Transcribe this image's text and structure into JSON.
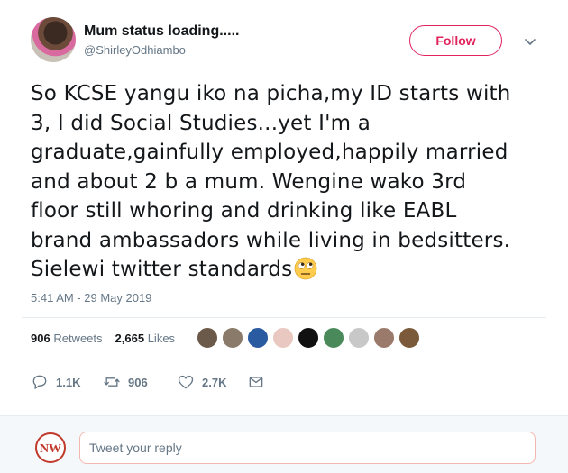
{
  "author": {
    "display_name": "Mum status loading.....",
    "username": "@ShirleyOdhiambo"
  },
  "follow_button": {
    "label": "Follow",
    "color": "#e0245e"
  },
  "menu": {
    "icon": "chevron-down-icon"
  },
  "tweet": {
    "line1": "So KCSE yangu iko na picha,my ID starts with",
    "line2": "3, I did Social Studies...yet I'm a",
    "line3": "graduate,gainfully employed,happily married",
    "line4": "and about 2 b a mum. Wengine wako 3rd",
    "line5": "floor still whoring and drinking like EABL",
    "line6": "brand ambassadors while living in bedsitters.",
    "line7": "Sielewi twitter standards",
    "emoji": "face-with-rolling-eyes-emoji"
  },
  "timestamp": "5:41 AM - 29 May 2019",
  "stats": {
    "retweets_count": "906",
    "retweets_label": "Retweets",
    "likes_count": "2,665",
    "likes_label": "Likes"
  },
  "liker_avatars": [
    "#6b5a4a",
    "#8a7a6a",
    "#2a5aa0",
    "#e8c8c0",
    "#111111",
    "#4a8a5a",
    "#c8c8c8",
    "#9a7a6a",
    "#7a5a3a"
  ],
  "actions": {
    "reply_count": "1.1K",
    "retweet_count": "906",
    "like_count": "2.7K"
  },
  "reply": {
    "logo_text": "NW",
    "placeholder": "Tweet your reply"
  }
}
